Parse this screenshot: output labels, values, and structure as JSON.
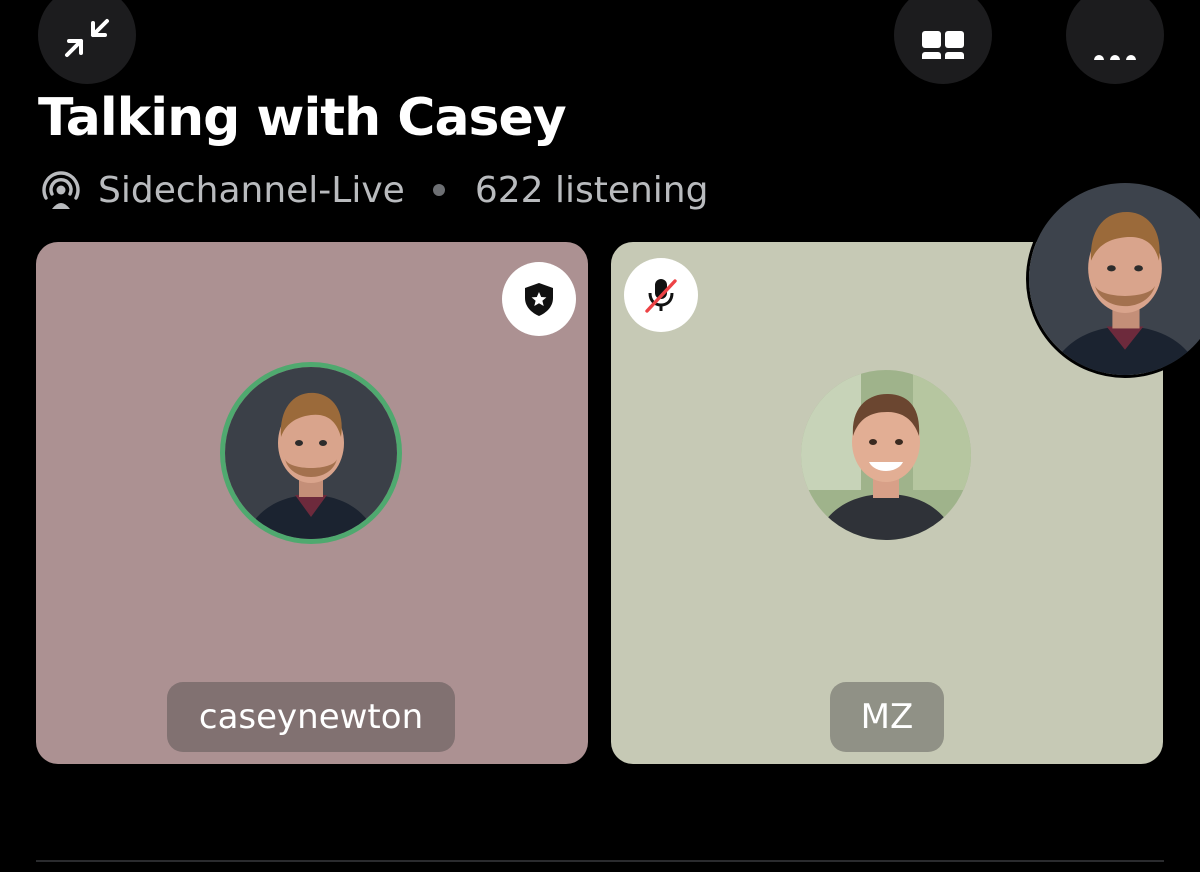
{
  "header": {
    "collapse_icon": "collapse-arrows-icon",
    "grid_icon": "grid-view-icon",
    "more_icon": "more-dots-icon"
  },
  "stage": {
    "title": "Talking with Casey",
    "channel": "Sidechannel-Live",
    "listeners": "622 listening",
    "icon": "stage-channel-icon"
  },
  "participants": [
    {
      "username": "caseynewton",
      "tile_color": "#ac9192",
      "badge_icon": "moderator-shield-icon",
      "speaking_ring_color": "#4fa96f"
    },
    {
      "username": "MZ",
      "tile_color": "#c6c9b5",
      "badge_icon": "muted-mic-icon"
    }
  ],
  "colors": {
    "background": "#000000",
    "muted_red": "#ed4245",
    "speaking_green": "#4fa96f"
  }
}
